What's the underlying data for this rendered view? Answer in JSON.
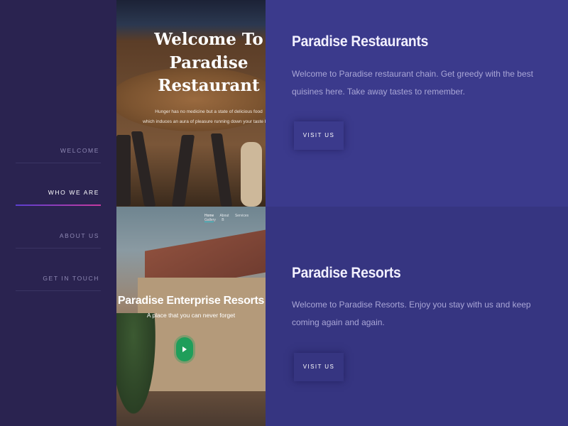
{
  "sidebar": {
    "items": [
      {
        "label": "WELCOME",
        "active": false
      },
      {
        "label": "WHO WE ARE",
        "active": true
      },
      {
        "label": "ABOUT US",
        "active": false
      },
      {
        "label": "GET IN TOUCH",
        "active": false
      }
    ]
  },
  "portfolio": [
    {
      "preview": {
        "heading_line1": "Welcome To",
        "heading_line2": "Paradise Restaurant",
        "tagline_line1": "Hunger has no medicine but a state of delicious food",
        "tagline_line2": "which induces an aura of pleasure running down your taste buds"
      },
      "title": "Paradise Restaurants",
      "description": "Welcome to Paradise restaurant chain. Get greedy with the best quisines here. Take away tastes to remember.",
      "button": "VISIT US"
    },
    {
      "preview": {
        "nav": [
          "Home",
          "About",
          "Services",
          "Gallery",
          "B"
        ],
        "heading": "Paradise Enterprise Resorts",
        "subheading": "A place that you can never forget"
      },
      "title": "Paradise Resorts",
      "description": "Welcome to Paradise Resorts. Enjoy you stay with us and keep coming again and again.",
      "button": "VISIT US"
    }
  ],
  "colors": {
    "sidebar_bg": "#2a2350",
    "panel_bg": "#3b3a8c",
    "active_underline_start": "#5a3fd0",
    "active_underline_end": "#c83aa0"
  }
}
